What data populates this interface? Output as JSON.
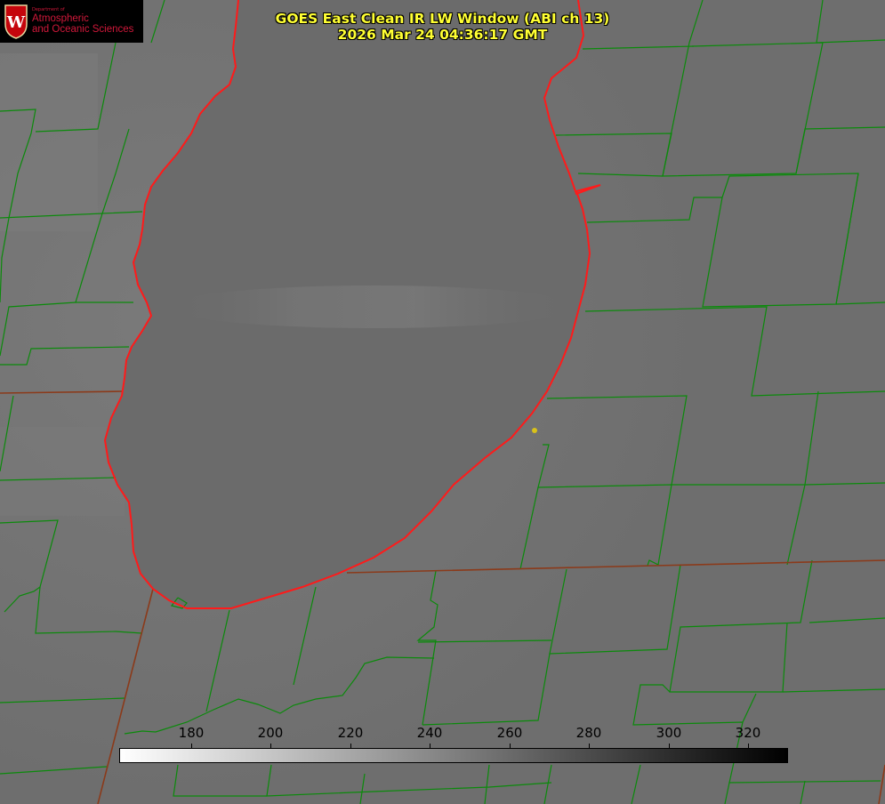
{
  "title": {
    "line1": "GOES East Clean IR LW Window (ABI ch 13)",
    "line2": "2026 Mar 24 04:36:17 GMT"
  },
  "logo": {
    "department_small": "Department of",
    "line1": "Atmospheric",
    "line2": "and Oceanic Sciences",
    "seal_letter": "W"
  },
  "colorbar": {
    "ticks": [
      "180",
      "200",
      "220",
      "240",
      "260",
      "280",
      "300",
      "320"
    ],
    "colors": {
      "low": "#ffffff",
      "high": "#000000"
    }
  },
  "map_colors": {
    "background": "#707070",
    "lake": "#6b6b6b",
    "county_lines": "#0b8a0b",
    "state_lines": "#8b3a1a",
    "coastline": "#ff1a1a",
    "marker": "#d9c21a"
  }
}
